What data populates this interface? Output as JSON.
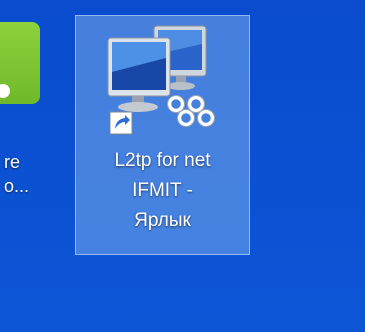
{
  "desktop": {
    "background_color": "#0b52d3"
  },
  "left_icon": {
    "icon": "green-app-icon",
    "label_line1": "re",
    "label_line2": "o..."
  },
  "shortcut": {
    "icon": "network-computers-icon",
    "overlay_icon": "shortcut-arrow-icon",
    "label_line1": "L2tp for net",
    "label_line2": "IFMIT -",
    "label_line3": "Ярлык",
    "selected": true
  }
}
